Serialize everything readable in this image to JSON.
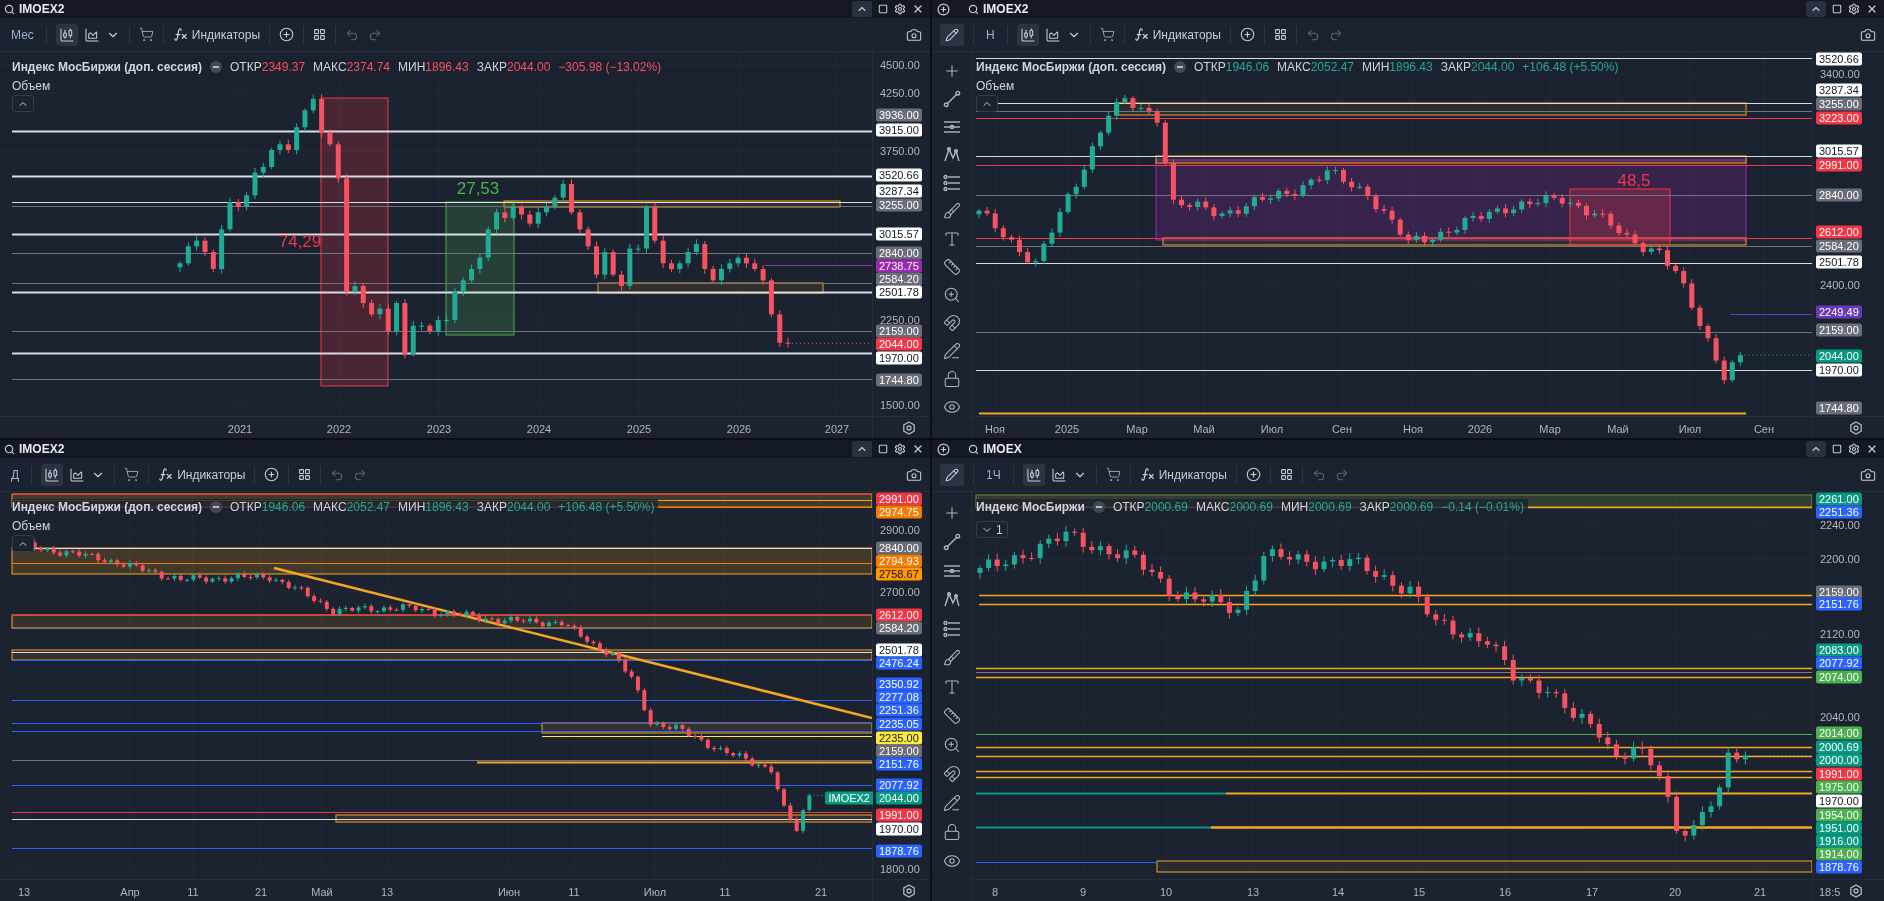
{
  "panels": [
    {
      "symbol": "IMOEX2",
      "timeframe": "Мес",
      "chart_styles": [
        {
          "kind": "candles",
          "selected": true
        },
        {
          "kind": "area",
          "selected": false
        }
      ],
      "indicators_label": "Индикаторы",
      "legend": {
        "name": "Индекс МосБиржи (доп. сессия)",
        "rising": false,
        "values": [
          {
            "label": "ОТКР",
            "value": "2349.37"
          },
          {
            "label": "МАКС",
            "value": "2374.74"
          },
          {
            "label": "МИН",
            "value": "1896.43"
          },
          {
            "label": "ЗАКР",
            "value": "2044.00"
          }
        ],
        "change": "−305.98 (−13.02%)"
      },
      "pane_label": "Объем",
      "pane_toggle": {
        "expanded": true
      },
      "annotations": [
        {
          "text": "74,29",
          "color": "#f23645"
        },
        {
          "text": "27,53",
          "color": "#4caf50"
        }
      ],
      "price_axis": [
        {
          "text": "4500.00",
          "kind": "tick"
        },
        {
          "text": "4250.00",
          "kind": "tick"
        },
        {
          "text": "3936.00",
          "kind": "tag",
          "color": "#6a6d78"
        },
        {
          "text": "3915.00",
          "kind": "tag",
          "color": "#ffffff"
        },
        {
          "text": "3750.00",
          "kind": "tick"
        },
        {
          "text": "3520.66",
          "kind": "tag",
          "color": "#ffffff"
        },
        {
          "text": "3287.34",
          "kind": "tag",
          "color": "#ffffff"
        },
        {
          "text": "3255.00",
          "kind": "tag",
          "color": "#6a6d78"
        },
        {
          "text": "3015.57",
          "kind": "tag",
          "color": "#ffffff"
        },
        {
          "text": "2840.00",
          "kind": "tag",
          "color": "#6a6d78"
        },
        {
          "text": "2738.75",
          "kind": "tag",
          "color": "#9c27b0"
        },
        {
          "text": "2584.20",
          "kind": "tag",
          "color": "#6a6d78"
        },
        {
          "text": "2501.78",
          "kind": "tag",
          "color": "#ffffff"
        },
        {
          "text": "2250.00",
          "kind": "tick"
        },
        {
          "text": "2159.00",
          "kind": "tag",
          "color": "#6a6d78"
        },
        {
          "text": "2044.00",
          "kind": "tag",
          "color": "#f23645"
        },
        {
          "text": "1970.00",
          "kind": "tag",
          "color": "#ffffff"
        },
        {
          "text": "1744.80",
          "kind": "tag",
          "color": "#6a6d78"
        },
        {
          "text": "1500.00",
          "kind": "tick"
        }
      ],
      "time_axis": [
        "2021",
        "2022",
        "2023",
        "2024",
        "2025",
        "2026",
        "2027"
      ]
    },
    {
      "add_button": true,
      "symbol": "IMOEX2",
      "drawing_toolbar": true,
      "timeframe": "Н",
      "chart_styles": [
        {
          "kind": "candles",
          "selected": true
        },
        {
          "kind": "area",
          "selected": false
        }
      ],
      "indicators_label": "Индикаторы",
      "legend": {
        "name": "Индекс МосБиржи (доп. сессия)",
        "rising": true,
        "values": [
          {
            "label": "ОТКР",
            "value": "1946.06"
          },
          {
            "label": "МАКС",
            "value": "2052.47"
          },
          {
            "label": "МИН",
            "value": "1896.43"
          },
          {
            "label": "ЗАКР",
            "value": "2044.00"
          }
        ],
        "change": "+106.48 (+5.50%)"
      },
      "pane_label": "Объем",
      "pane_toggle": {
        "expanded": true
      },
      "annotations": [
        {
          "text": "48,5",
          "color": "#f23645"
        }
      ],
      "price_axis": [
        {
          "text": "3520.66",
          "kind": "tag",
          "color": "#ffffff"
        },
        {
          "text": "3400.00",
          "kind": "tick"
        },
        {
          "text": "3287.34",
          "kind": "tag",
          "color": "#ffffff"
        },
        {
          "text": "3255.00",
          "kind": "tag",
          "color": "#6a6d78"
        },
        {
          "text": "3223.00",
          "kind": "tag",
          "color": "#f23645"
        },
        {
          "text": "3015.57",
          "kind": "tag",
          "color": "#ffffff"
        },
        {
          "text": "2991.00",
          "kind": "tag",
          "color": "#f23645"
        },
        {
          "text": "2840.00",
          "kind": "tag",
          "color": "#6a6d78"
        },
        {
          "text": "2612.00",
          "kind": "tag",
          "color": "#f23645"
        },
        {
          "text": "2584.20",
          "kind": "tag",
          "color": "#6a6d78"
        },
        {
          "text": "2501.78",
          "kind": "tag",
          "color": "#ffffff"
        },
        {
          "text": "2400.00",
          "kind": "tick"
        },
        {
          "text": "2249.49",
          "kind": "tag",
          "color": "#673ab7"
        },
        {
          "text": "2159.00",
          "kind": "tag",
          "color": "#6a6d78"
        },
        {
          "text": "2044.00",
          "kind": "tag",
          "color": "#089981"
        },
        {
          "text": "1970.00",
          "kind": "tag",
          "color": "#ffffff"
        },
        {
          "text": "1744.80",
          "kind": "tag",
          "color": "#6a6d78"
        }
      ],
      "time_axis": [
        "Ноя",
        "2025",
        "Мар",
        "Май",
        "Июл",
        "Сен",
        "Ноя",
        "2026",
        "Мар",
        "Май",
        "Июл",
        "Сен"
      ]
    },
    {
      "symbol": "IMOEX2",
      "timeframe": "Д",
      "chart_styles": [
        {
          "kind": "candles",
          "selected": true
        },
        {
          "kind": "area",
          "selected": false
        }
      ],
      "indicators_label": "Индикаторы",
      "legend": {
        "name": "Индекс МосБиржи (доп. сессия)",
        "rising": true,
        "values": [
          {
            "label": "ОТКР",
            "value": "1946.06"
          },
          {
            "label": "МАКС",
            "value": "2052.47"
          },
          {
            "label": "МИН",
            "value": "1896.43"
          },
          {
            "label": "ЗАКР",
            "value": "2044.00"
          }
        ],
        "change": "+106.48 (+5.50%)"
      },
      "pane_label": "Объем",
      "pane_toggle": {
        "expanded": true
      },
      "price_axis": [
        {
          "text": "2991.00",
          "kind": "tag",
          "color": "#f23645"
        },
        {
          "text": "2974.75",
          "kind": "tag",
          "color": "#f57c00"
        },
        {
          "text": "2900.00",
          "kind": "tick"
        },
        {
          "text": "2840.00",
          "kind": "tag",
          "color": "#6a6d78"
        },
        {
          "text": "2794.93",
          "kind": "tag",
          "color": "#f57c00"
        },
        {
          "text": "2758.67",
          "kind": "tag",
          "color": "#ff9800"
        },
        {
          "text": "2700.00",
          "kind": "tick"
        },
        {
          "text": "2612.00",
          "kind": "tag",
          "color": "#f23645"
        },
        {
          "text": "2584.20",
          "kind": "tag",
          "color": "#6a6d78"
        },
        {
          "text": "2501.78",
          "kind": "tag",
          "color": "#ffffff"
        },
        {
          "text": "2476.24",
          "kind": "tag",
          "color": "#2962ff"
        },
        {
          "text": "2350.92",
          "kind": "tag",
          "color": "#2962ff"
        },
        {
          "text": "2277.08",
          "kind": "tag",
          "color": "#2962ff"
        },
        {
          "text": "2251.36",
          "kind": "tag",
          "color": "#2962ff"
        },
        {
          "text": "2235.05",
          "kind": "tag",
          "color": "#2962ff"
        },
        {
          "text": "2235.00",
          "kind": "tag",
          "color": "#ffeb3b"
        },
        {
          "text": "2159.00",
          "kind": "tag",
          "color": "#6a6d78"
        },
        {
          "text": "2151.76",
          "kind": "tag",
          "color": "#2962ff"
        },
        {
          "text": "2077.92",
          "kind": "tag",
          "color": "#2962ff"
        },
        {
          "text": "2044.00",
          "kind": "tag",
          "color": "#089981",
          "series_label": "IMOEX2"
        },
        {
          "text": "1991.00",
          "kind": "tag",
          "color": "#f23645"
        },
        {
          "text": "1970.00",
          "kind": "tag",
          "color": "#ffffff"
        },
        {
          "text": "1878.76",
          "kind": "tag",
          "color": "#2962ff"
        },
        {
          "text": "1800.00",
          "kind": "tick"
        }
      ],
      "time_axis": [
        "13",
        "Апр",
        "11",
        "21",
        "Май",
        "13",
        "Июн",
        "11",
        "Июл",
        "11",
        "21"
      ]
    },
    {
      "add_button": true,
      "symbol": "IMOEX",
      "drawing_toolbar": true,
      "timeframe": "1Ч",
      "chart_styles": [
        {
          "kind": "candles",
          "selected": true
        },
        {
          "kind": "area",
          "selected": false
        }
      ],
      "indicators_label": "Индикаторы",
      "legend": {
        "name": "Индекс МосБиржи",
        "rising": true,
        "values": [
          {
            "label": "ОТКР",
            "value": "2000.69"
          },
          {
            "label": "МАКС",
            "value": "2000.69"
          },
          {
            "label": "МИН",
            "value": "2000.69"
          },
          {
            "label": "ЗАКР",
            "value": "2000.69"
          }
        ],
        "change": "−0.14 (−0.01%)"
      },
      "pane_toggle": {
        "expanded": false,
        "count": "1"
      },
      "price_axis": [
        {
          "text": "2261.00",
          "kind": "tag",
          "color": "#089981"
        },
        {
          "text": "2251.36",
          "kind": "tag",
          "color": "#2962ff"
        },
        {
          "text": "2240.00",
          "kind": "tick"
        },
        {
          "text": "2200.00",
          "kind": "tick"
        },
        {
          "text": "2159.00",
          "kind": "tag",
          "color": "#6a6d78"
        },
        {
          "text": "2151.76",
          "kind": "tag",
          "color": "#2962ff"
        },
        {
          "text": "2120.00",
          "kind": "tick"
        },
        {
          "text": "2083.00",
          "kind": "tag",
          "color": "#089981"
        },
        {
          "text": "2077.92",
          "kind": "tag",
          "color": "#2962ff"
        },
        {
          "text": "2074.00",
          "kind": "tag",
          "color": "#4caf50"
        },
        {
          "text": "2040.00",
          "kind": "tick"
        },
        {
          "text": "2014.00",
          "kind": "tag",
          "color": "#4caf50"
        },
        {
          "text": "2000.69",
          "kind": "tag",
          "color": "#089981"
        },
        {
          "text": "2000.00",
          "kind": "tag",
          "color": "#089981"
        },
        {
          "text": "1991.00",
          "kind": "tag",
          "color": "#f23645"
        },
        {
          "text": "1975.00",
          "kind": "tag",
          "color": "#4caf50"
        },
        {
          "text": "1970.00",
          "kind": "tag",
          "color": "#ffffff"
        },
        {
          "text": "1954.00",
          "kind": "tag",
          "color": "#4caf50"
        },
        {
          "text": "1951.00",
          "kind": "tag",
          "color": "#089981"
        },
        {
          "text": "1916.00",
          "kind": "tag",
          "color": "#089981"
        },
        {
          "text": "1914.00",
          "kind": "tag",
          "color": "#4caf50"
        },
        {
          "text": "1878.76",
          "kind": "tag",
          "color": "#2962ff"
        }
      ],
      "time_axis": [
        "8",
        "9",
        "10",
        "13",
        "14",
        "15",
        "16",
        "17",
        "20",
        "21"
      ],
      "time_marker": "18:5"
    }
  ]
}
